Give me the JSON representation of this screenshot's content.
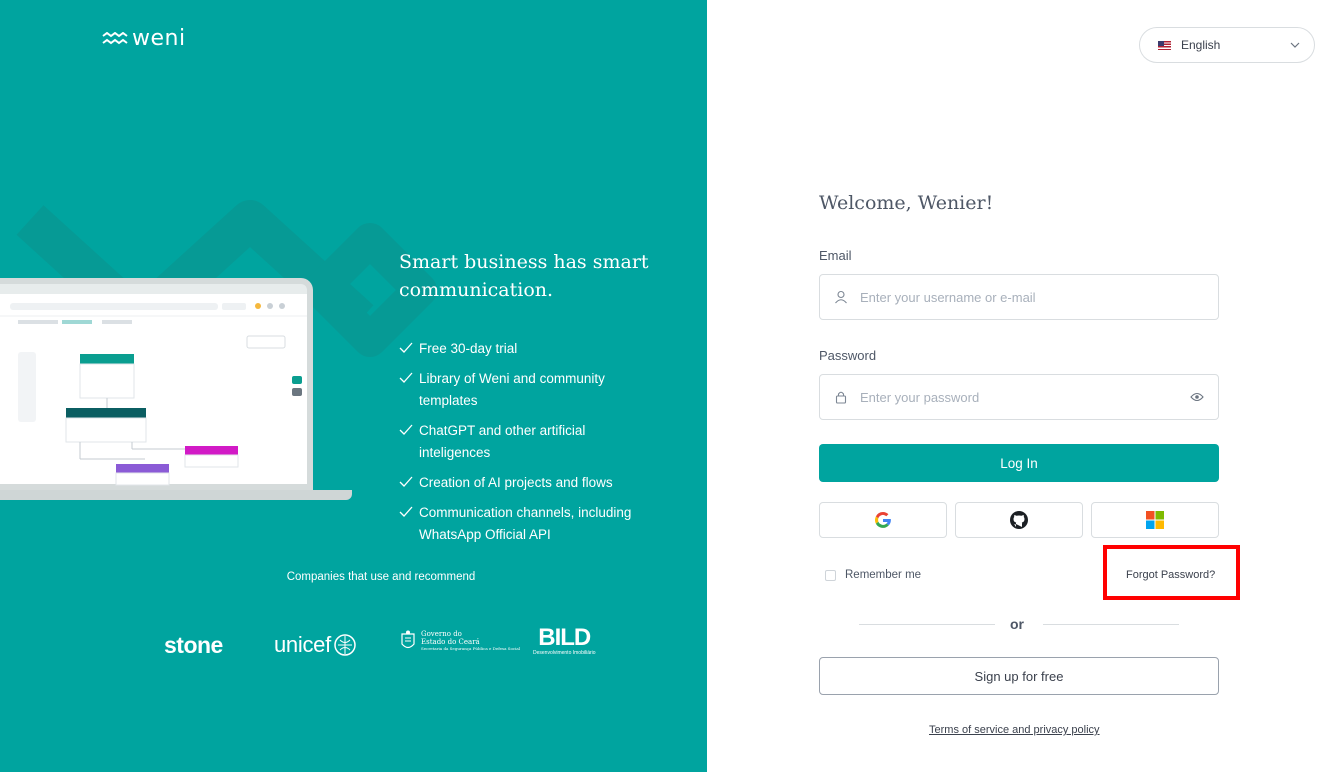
{
  "brand": {
    "name": "weni",
    "color": "#00A49F"
  },
  "left": {
    "tagline": "Smart business has smart communication.",
    "features": [
      "Free 30-day trial",
      "Library of Weni and community templates",
      "ChatGPT and other artificial inteligences",
      "Creation of AI projects and flows",
      "Communication channels, including WhatsApp Official API"
    ],
    "companies_title": "Companies that use and recommend",
    "companies": {
      "stone": "stone",
      "unicef": "unicef",
      "governo_line1": "Governo do",
      "governo_line2": "Estado do Ceará",
      "governo_sub": "Secretaria da Segurança Pública e Defesa Social",
      "bild": "BILD",
      "bild_sub": "Desenvolvimento Imobiliário"
    }
  },
  "language": {
    "selected": "English",
    "icon": "chevron-down-icon"
  },
  "form": {
    "welcome": "Welcome, Wenier!",
    "email_label": "Email",
    "email_placeholder": "Enter your username or e-mail",
    "password_label": "Password",
    "password_placeholder": "Enter your password",
    "login_label": "Log In",
    "remember_label": "Remember me",
    "forgot_label": "Forgot Password?",
    "or_label": "or",
    "signup_label": "Sign up for free",
    "terms_label": "Terms of service and privacy policy"
  },
  "sso": [
    "google-icon",
    "github-icon",
    "microsoft-icon"
  ],
  "colors": {
    "accent": "#00A49F",
    "highlight": "#ff0000"
  }
}
